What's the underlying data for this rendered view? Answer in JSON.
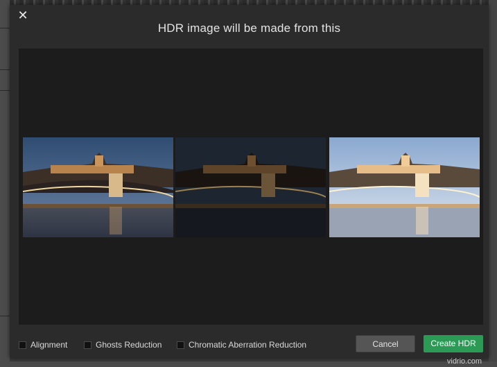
{
  "dialog": {
    "title": "HDR image will be made from this",
    "close_icon": "close-icon",
    "preview_images": [
      {
        "name": "normal-exposure",
        "tone": "normal"
      },
      {
        "name": "under-exposure",
        "tone": "dark"
      },
      {
        "name": "over-exposure",
        "tone": "bright"
      }
    ],
    "options": [
      {
        "label": "Alignment",
        "checked": false
      },
      {
        "label": "Ghosts Reduction",
        "checked": false
      },
      {
        "label": "Chromatic Aberration Reduction",
        "checked": false
      }
    ],
    "cancel_label": "Cancel",
    "create_label": "Create HDR"
  },
  "colors": {
    "dialog_bg": "#2b2b2b",
    "preview_bg": "#1c1c1c",
    "accent_green": "#2a9a55"
  },
  "watermark": "vidrio.com"
}
